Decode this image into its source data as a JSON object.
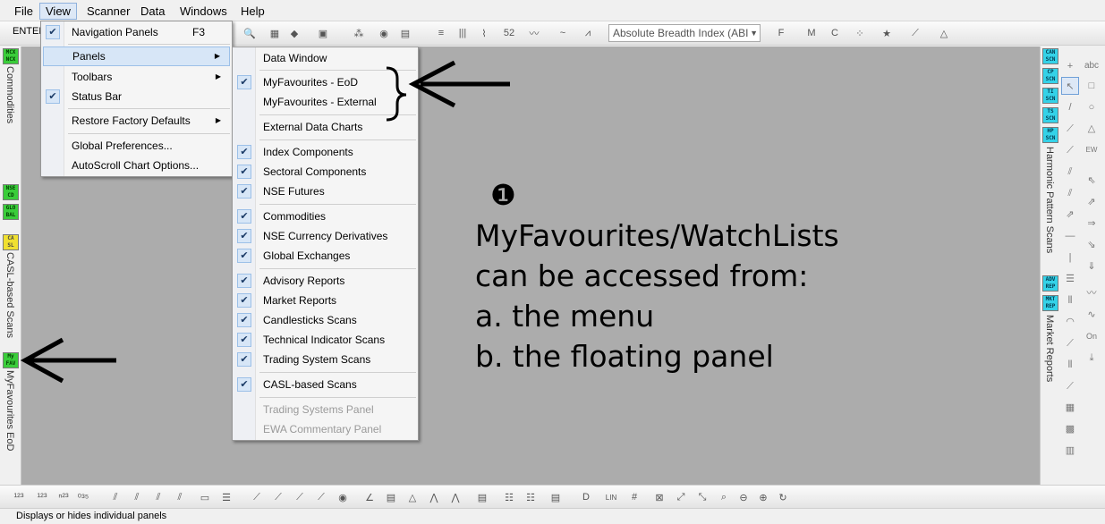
{
  "menubar": {
    "file": "File",
    "view": "View",
    "scanner": "Scanner",
    "data": "Data",
    "windows": "Windows",
    "help": "Help"
  },
  "toolbar": {
    "enter": "ENTER",
    "index_combo": "Absolute Breadth Index (ABI"
  },
  "left_panel": {
    "commodities_tag": "MCX NCX",
    "commodities_label": "Commodities",
    "nse_tag": "NSE CD",
    "global_tag": "GLO BAL",
    "casl_tag": "CA SL",
    "casl_label": "CASL-based Scans",
    "myfav_tag": "My FAV",
    "myfav_label": "MyFavourites EoD"
  },
  "right_panel": {
    "tags": [
      "CAN SCN",
      "CP SCN",
      "TI SCN",
      "TS SCN",
      "HP SCN"
    ],
    "harmonic_label": "Harmonic Pattern Scans",
    "report_tags": [
      "ADV REP",
      "MKT REP"
    ],
    "market_reports_label": "Market Reports"
  },
  "view_menu": {
    "items": [
      {
        "label": "Navigation Panels",
        "shortcut": "F3",
        "checked": true
      },
      {
        "label": "Panels",
        "submenu": true,
        "highlighted": true
      },
      {
        "label": "Toolbars",
        "submenu": true
      },
      {
        "label": "Status Bar",
        "checked": true
      },
      {
        "label": "Restore Factory Defaults",
        "submenu": true
      },
      {
        "label": "Global Preferences..."
      },
      {
        "label": "AutoScroll Chart Options..."
      }
    ]
  },
  "panels_menu": {
    "items": [
      {
        "label": "Data Window",
        "checked": false
      },
      {
        "label": "MyFavourites - EoD",
        "checked": true
      },
      {
        "label": "MyFavourites - External",
        "checked": false
      },
      {
        "label": "External Data Charts",
        "checked": false
      },
      {
        "label": "Index Components",
        "checked": true
      },
      {
        "label": "Sectoral Components",
        "checked": true
      },
      {
        "label": "NSE Futures",
        "checked": true
      },
      {
        "label": "Commodities",
        "checked": true
      },
      {
        "label": "NSE Currency Derivatives",
        "checked": true
      },
      {
        "label": "Global Exchanges",
        "checked": true
      },
      {
        "label": "Advisory Reports",
        "checked": true
      },
      {
        "label": "Market Reports",
        "checked": true
      },
      {
        "label": "Candlesticks Scans",
        "checked": true
      },
      {
        "label": "Technical Indicator Scans",
        "checked": true
      },
      {
        "label": "Trading System Scans",
        "checked": true
      },
      {
        "label": "CASL-based Scans",
        "checked": true
      },
      {
        "label": "Trading Systems Panel",
        "disabled": true
      },
      {
        "label": "EWA Commentary Panel",
        "disabled": true
      }
    ]
  },
  "annotation": {
    "bullet": "❶",
    "lines": [
      "MyFavourites/WatchLists",
      "can be accessed from:",
      "a. the menu",
      "b. the floating panel"
    ]
  },
  "status": {
    "text": "Displays or hides individual panels"
  },
  "colors": {
    "chart_bg": "#acacac",
    "tag_green": "#3acd3a",
    "tag_cyan": "#34d2e8",
    "tag_yellow": "#f0e030"
  }
}
